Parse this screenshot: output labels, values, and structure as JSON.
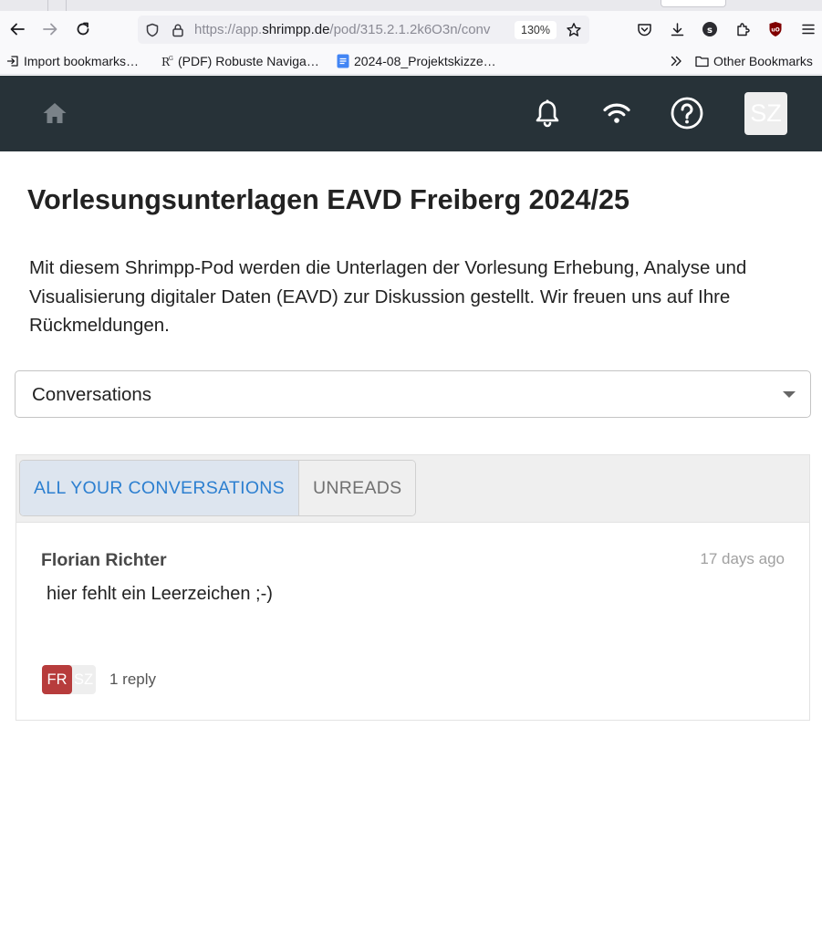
{
  "browser": {
    "url_prefix": "https://app.",
    "url_host": "shrimpp.de",
    "url_path": "/pod/315.2.1.2k6O3n/conv",
    "zoom": "130%",
    "bookmarks": [
      {
        "label": "Import bookmarks…",
        "icon": "import-icon"
      },
      {
        "label": "(PDF) Robuste Naviga…",
        "icon": "researchgate-icon"
      },
      {
        "label": "2024-08_Projektskizze…",
        "icon": "google-docs-icon"
      }
    ],
    "other_bookmarks": "Other Bookmarks"
  },
  "header": {
    "avatar_initials": "SZ"
  },
  "page": {
    "title": "Vorlesungsunterlagen EAVD Freiberg 2024/25",
    "description": "Mit diesem Shrimpp-Pod werden die Unterlagen der Vorlesung Erhebung, Analyse und Visualisierung digitaler Daten (EAVD) zur Diskussion gestellt. Wir freuen uns auf Ihre Rückmeldungen.",
    "view_select": "Conversations"
  },
  "tabs": {
    "all": "ALL YOUR CONVERSATIONS",
    "unreads": "UNREADS"
  },
  "conversation": {
    "author": "Florian Richter",
    "time": "17 days ago",
    "message": "hier fehlt ein Leerzeichen ;-)",
    "participant_1": "FR",
    "participant_2": "SZ",
    "replies": "1 reply"
  },
  "colors": {
    "appbar": "#273238",
    "accent": "#2c7fd0",
    "avatar_fr": "#b73c3c"
  }
}
